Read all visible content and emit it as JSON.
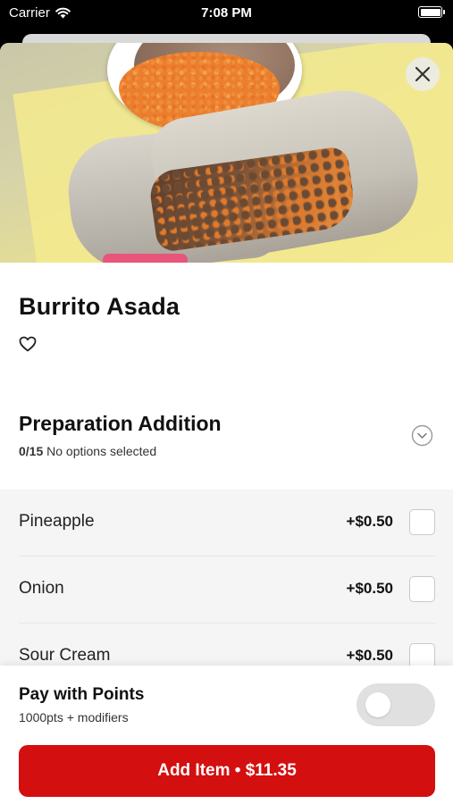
{
  "status_bar": {
    "carrier": "Carrier",
    "time": "7:08 PM"
  },
  "item": {
    "name": "Burrito Asada"
  },
  "section": {
    "title": "Preparation Addition",
    "count": "0/15",
    "status": "No options selected"
  },
  "options": [
    {
      "label": "Pineapple",
      "price": "+$0.50",
      "checked": false
    },
    {
      "label": "Onion",
      "price": "+$0.50",
      "checked": false
    },
    {
      "label": "Sour Cream",
      "price": "+$0.50",
      "checked": false
    }
  ],
  "points": {
    "title": "Pay with Points",
    "subtitle": "1000pts + modifiers",
    "enabled": false
  },
  "add_button": {
    "label": "Add Item • $11.35"
  },
  "colors": {
    "accent": "#d30f0f",
    "toggle_off": "#e0e0e0",
    "options_bg": "#f5f5f5"
  },
  "icons": {
    "close": "close-icon",
    "favorite": "heart-icon",
    "expand": "chevron-down-icon",
    "wifi": "wifi-icon",
    "battery": "battery-icon"
  }
}
